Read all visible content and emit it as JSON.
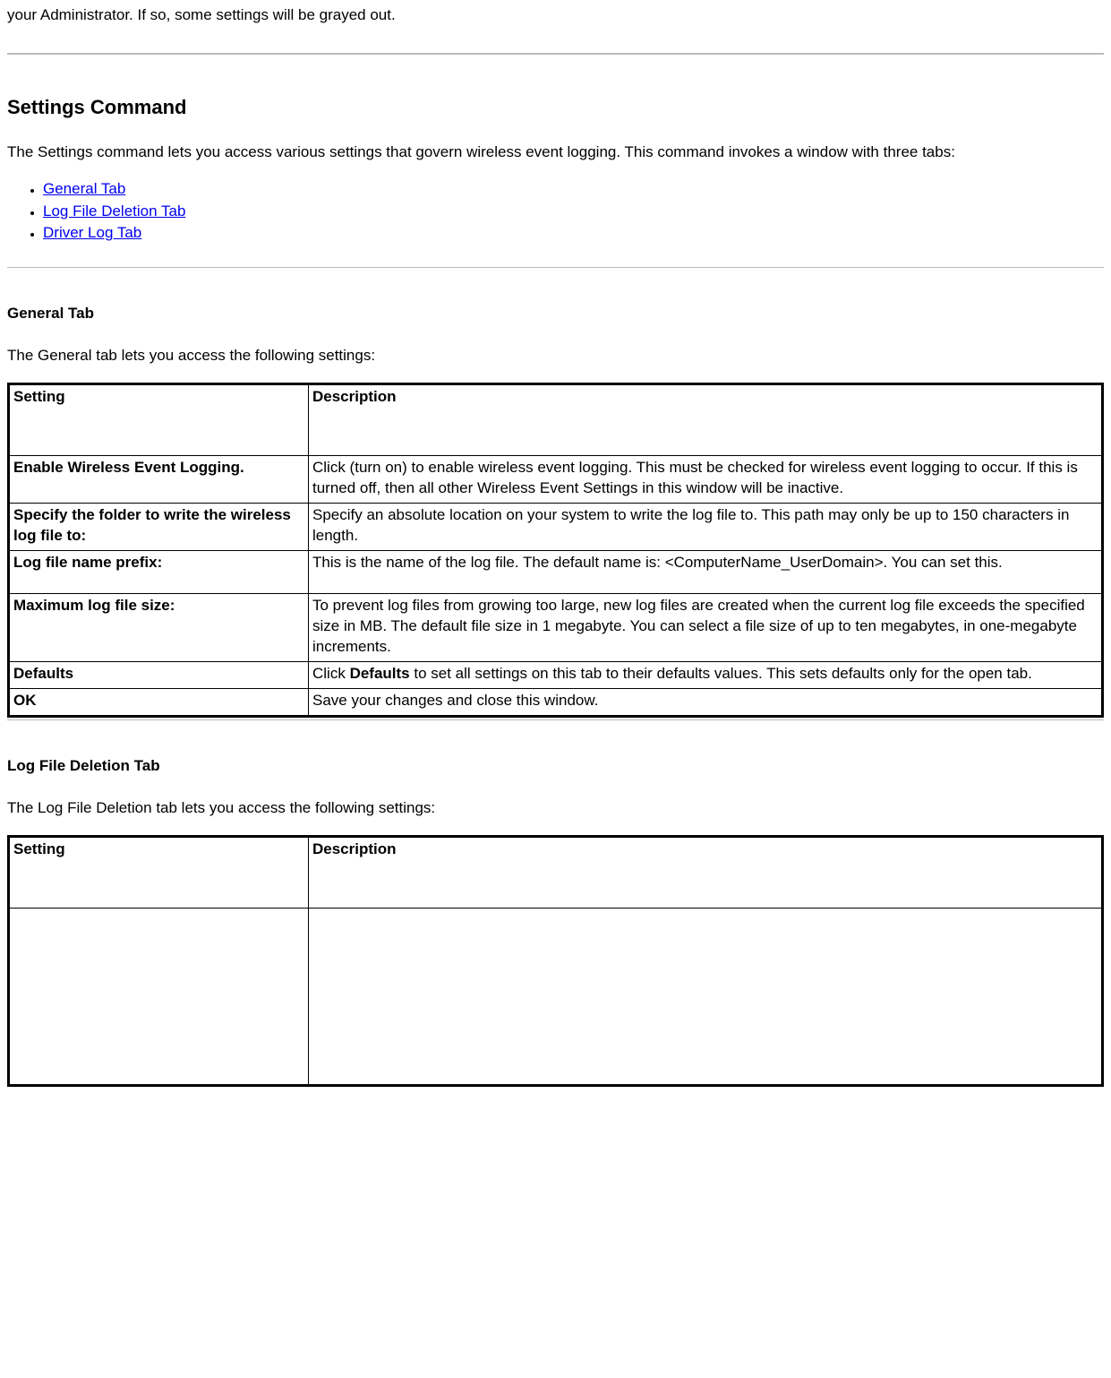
{
  "intro_fragment": "your Administrator. If so, some settings will be grayed out.",
  "settings_command": {
    "heading": "Settings Command",
    "paragraph": "The Settings command lets you access various settings that govern wireless event logging. This command invokes a window with three tabs:",
    "links": [
      "General Tab ",
      "Log File Deletion Tab",
      "Driver Log Tab"
    ]
  },
  "general_tab": {
    "heading": "General Tab",
    "paragraph": "The General tab lets you access the following settings:",
    "headers": {
      "col1": "Setting",
      "col2": "Description"
    },
    "rows": [
      {
        "setting": "Enable Wireless Event Logging.",
        "description": "Click (turn on) to enable wireless event logging. This must be checked for wireless event logging to occur. If this is turned off, then all other Wireless Event Settings in this window will be inactive."
      },
      {
        "setting": "Specify the folder to write the wireless log file to:",
        "description": "Specify an absolute location on your system to write the log file to. This path may only be up to 150 characters in length."
      },
      {
        "setting": "Log file name prefix:",
        "description": "This is the name of the log file. The default name is: <ComputerName_UserDomain>. You can set this."
      },
      {
        "setting": "Maximum log file size:",
        "description": "To prevent log files from growing too large, new log files are created when the current log file exceeds the specified size in MB. The default file size in 1 megabyte. You can select a file size of up to ten megabytes, in one-megabyte increments."
      },
      {
        "setting": "Defaults",
        "desc_prefix": "Click ",
        "desc_bold": "Defaults",
        "desc_suffix": " to set all settings on this tab to their defaults values. This sets defaults only for the open tab."
      },
      {
        "setting": "OK",
        "description": "Save your changes and close this window."
      }
    ]
  },
  "log_file_deletion_tab": {
    "heading": "Log File Deletion Tab",
    "paragraph": "The Log File Deletion tab lets you access the following settings:",
    "headers": {
      "col1": "Setting",
      "col2": "Description"
    }
  }
}
